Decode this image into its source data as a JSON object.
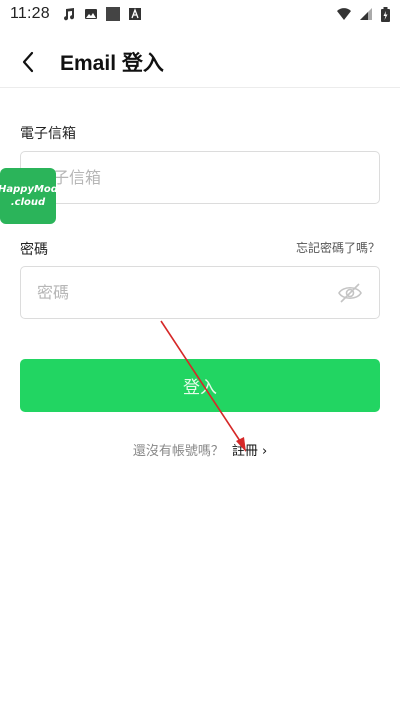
{
  "status_bar": {
    "time": "11:28"
  },
  "header": {
    "title": "Email 登入"
  },
  "email": {
    "label": "電子信箱",
    "placeholder": "電子信箱",
    "value": ""
  },
  "password": {
    "label": "密碼",
    "placeholder": "密碼",
    "value": "",
    "forgot_label": "忘記密碼了嗎？"
  },
  "login_button": {
    "label": "登入",
    "color": "#22d562"
  },
  "signup": {
    "prompt": "還沒有帳號嗎？",
    "link_label": "註冊 ›"
  },
  "watermark": {
    "line1": "HappyMod",
    "line2": ".cloud"
  },
  "annotation": {
    "color": "#d62828"
  }
}
